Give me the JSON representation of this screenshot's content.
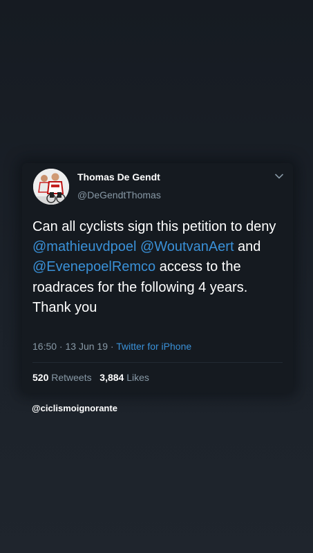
{
  "tweet": {
    "author": {
      "display_name": "Thomas De Gendt",
      "handle": "@DeGendtThomas"
    },
    "text": {
      "part1": "Can all cyclists sign this petition to deny ",
      "mention1": "@mathieuvdpoel",
      "space1": " ",
      "mention2": "@WoutvanAert",
      "part2": " and ",
      "mention3": "@EvenepoelRemco",
      "part3": " access to the roadraces for the following 4 years. Thank you"
    },
    "time": "16:50",
    "separator": " · ",
    "date": "13 Jun 19",
    "source": "Twitter for iPhone",
    "retweets_count": "520",
    "retweets_label": "Retweets",
    "likes_count": "3,884",
    "likes_label": "Likes"
  },
  "watermark": "@ciclismoignorante",
  "icons": {
    "caret": "chevron-down-icon",
    "avatar": "profile-photo"
  },
  "colors": {
    "background": "#1b2129",
    "card": "#151a20",
    "link": "#3a91d8",
    "secondary_text": "#8899a6"
  }
}
